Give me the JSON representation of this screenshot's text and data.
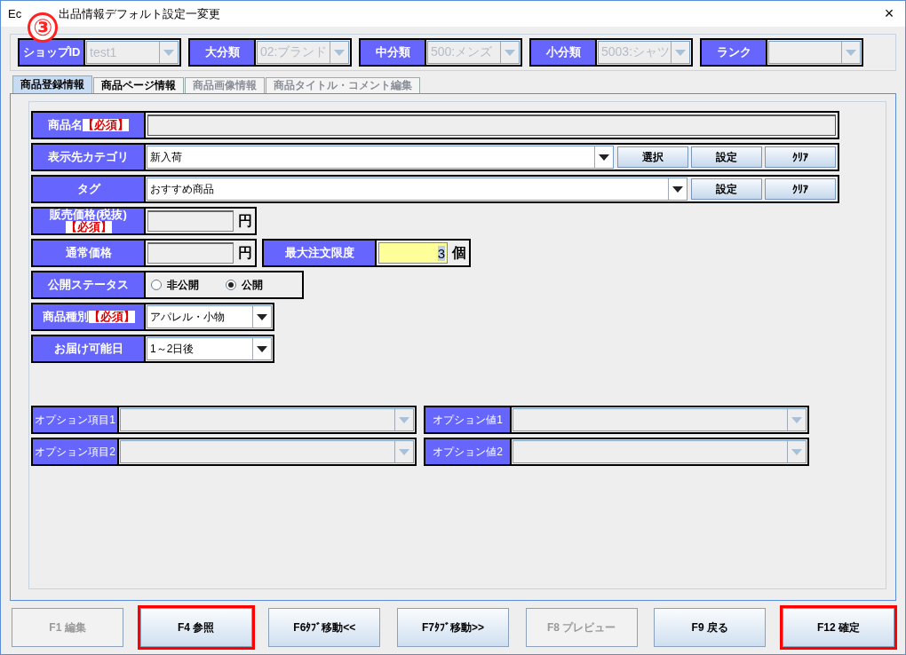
{
  "window": {
    "title_start": "Ec",
    "title_rest": "出品情報デフォルト設定一変更",
    "close": "×",
    "annotation": "③"
  },
  "filters": [
    {
      "label": "ショップID",
      "value": "test1",
      "disabled": true
    },
    {
      "label": "大分類",
      "value": "02:ブランド",
      "disabled": true
    },
    {
      "label": "中分類",
      "value": "500:メンズ",
      "disabled": true
    },
    {
      "label": "小分類",
      "value": "5003:シャツ",
      "disabled": true
    },
    {
      "label": "ランク",
      "disabled": true
    }
  ],
  "tabs": [
    {
      "label": "商品登録情報",
      "selected": true,
      "disabled": false
    },
    {
      "label": "商品ページ情報",
      "selected": false,
      "disabled": false
    },
    {
      "label": "商品画像情報",
      "selected": false,
      "disabled": true
    },
    {
      "label": "商品タイトル・コメント編集",
      "selected": false,
      "disabled": true
    }
  ],
  "form": [
    {
      "kind": "text",
      "label": "商品名",
      "required": "【必須】"
    },
    {
      "kind": "combo",
      "label": "表示先カテゴリ",
      "value": "新入荷",
      "buttons": [
        "選択",
        "設定",
        "ｸﾘｱ"
      ]
    },
    {
      "kind": "combo",
      "label": "タグ",
      "value": "おすすめ商品",
      "buttons": [
        "設定",
        "ｸﾘｱ"
      ]
    },
    {
      "kind": "price",
      "label": "販売価格(税抜)",
      "required": "【必須】",
      "unit": "円"
    },
    {
      "kind": "price",
      "label": "通常価格",
      "unit": "円",
      "extra": {
        "label": "最大注文限度",
        "value": "3",
        "unit": "個"
      }
    },
    {
      "kind": "radio",
      "label": "公開ステータス",
      "options": [
        {
          "label": "非公開",
          "selected": false
        },
        {
          "label": "公開",
          "selected": true
        }
      ]
    },
    {
      "kind": "select",
      "label": "商品種別",
      "required": "【必須】",
      "value": "アパレル・小物"
    },
    {
      "kind": "select",
      "label": "お届け可能日",
      "value": "1～2日後"
    }
  ],
  "options": [
    {
      "label": "オプション項目1",
      "disabled": true
    },
    {
      "label": "オプション値1",
      "disabled": true
    },
    {
      "label": "オプション項目2",
      "disabled": true
    },
    {
      "label": "オプション値2",
      "disabled": true
    }
  ],
  "buttons": [
    {
      "label": "F1 編集",
      "disabled": true,
      "highlighted": false
    },
    {
      "label": "F4 参照",
      "disabled": false,
      "highlighted": true
    },
    {
      "label": "F6ﾀﾌﾞ移動<<",
      "disabled": false,
      "highlighted": false
    },
    {
      "label": "F7ﾀﾌﾞ移動>>",
      "disabled": false,
      "highlighted": false
    },
    {
      "label": "F8 プレビュー",
      "disabled": true,
      "highlighted": false
    },
    {
      "label": "F9 戻る",
      "disabled": false,
      "highlighted": false
    },
    {
      "label": "F12 確定",
      "disabled": false,
      "highlighted": true
    }
  ]
}
